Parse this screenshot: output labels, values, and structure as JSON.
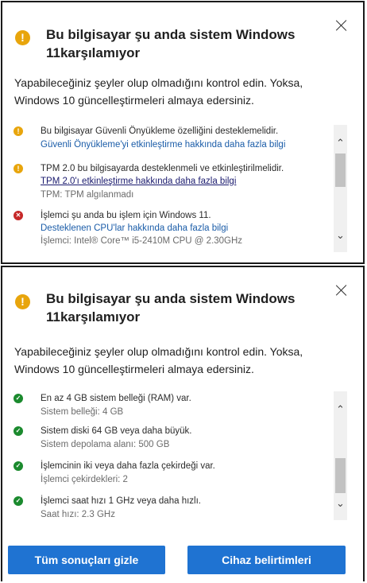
{
  "panel1": {
    "title": "Bu bilgisayar şu anda sistem Windows 11karşılamıyor",
    "intro": "Yapabileceğiniz şeyler olup olmadığını kontrol edin. Yoksa, Windows 10 güncelleştirmeleri almaya edersiniz.",
    "items": [
      {
        "status": "warning",
        "text": "Bu bilgisayar Güvenli Önyükleme özelliğini desteklemelidir.",
        "link": "Güvenli Önyükleme'yi etkinleştirme hakkında daha fazla bilgi"
      },
      {
        "status": "warning",
        "text": "TPM 2.0 bu bilgisayarda desteklenmeli ve etkinleştirilmelidir.",
        "link": "TPM 2.0'ı etkinleştirme hakkında daha fazla bilgi",
        "detail": "TPM: TPM algılanmadı"
      },
      {
        "status": "error",
        "text": "İşlemci şu anda bu işlem için Windows 11.",
        "link": "Desteklenen CPU'lar hakkında daha fazla bilgi",
        "detail": "İşlemci: Intel® Core™ i5-2410M CPU @ 2.30GHz"
      }
    ]
  },
  "panel2": {
    "title": "Bu bilgisayar şu anda sistem Windows 11karşılamıyor",
    "intro": "Yapabileceğiniz şeyler olup olmadığını kontrol edin. Yoksa, Windows 10 güncelleştirmeleri almaya edersiniz.",
    "items": [
      {
        "status": "ok",
        "text": "En az 4 GB sistem belleği (RAM) var.",
        "detail": "Sistem belleği: 4 GB"
      },
      {
        "status": "ok",
        "text": "Sistem diski 64 GB veya daha büyük.",
        "detail": "Sistem depolama alanı: 500 GB"
      },
      {
        "status": "ok",
        "text": "İşlemcinin iki veya daha fazla çekirdeği var.",
        "detail": "İşlemci çekirdekleri: 2"
      },
      {
        "status": "ok",
        "text": "İşlemci saat hızı 1 GHz veya daha hızlı.",
        "detail": "Saat hızı: 2.3 GHz"
      }
    ]
  },
  "buttons": {
    "hide_all": "Tüm sonuçları gizle",
    "device_specs": "Cihaz belirtimleri"
  },
  "icons": {
    "warning": "!",
    "error": "✕",
    "ok": "✓",
    "scroll_up": "⌃",
    "scroll_down": "⌄"
  },
  "colors": {
    "accent": "#1f73d2",
    "warning": "#e8a50c",
    "error": "#c62828",
    "ok": "#1b8a2e",
    "link": "#1a5ca8"
  }
}
